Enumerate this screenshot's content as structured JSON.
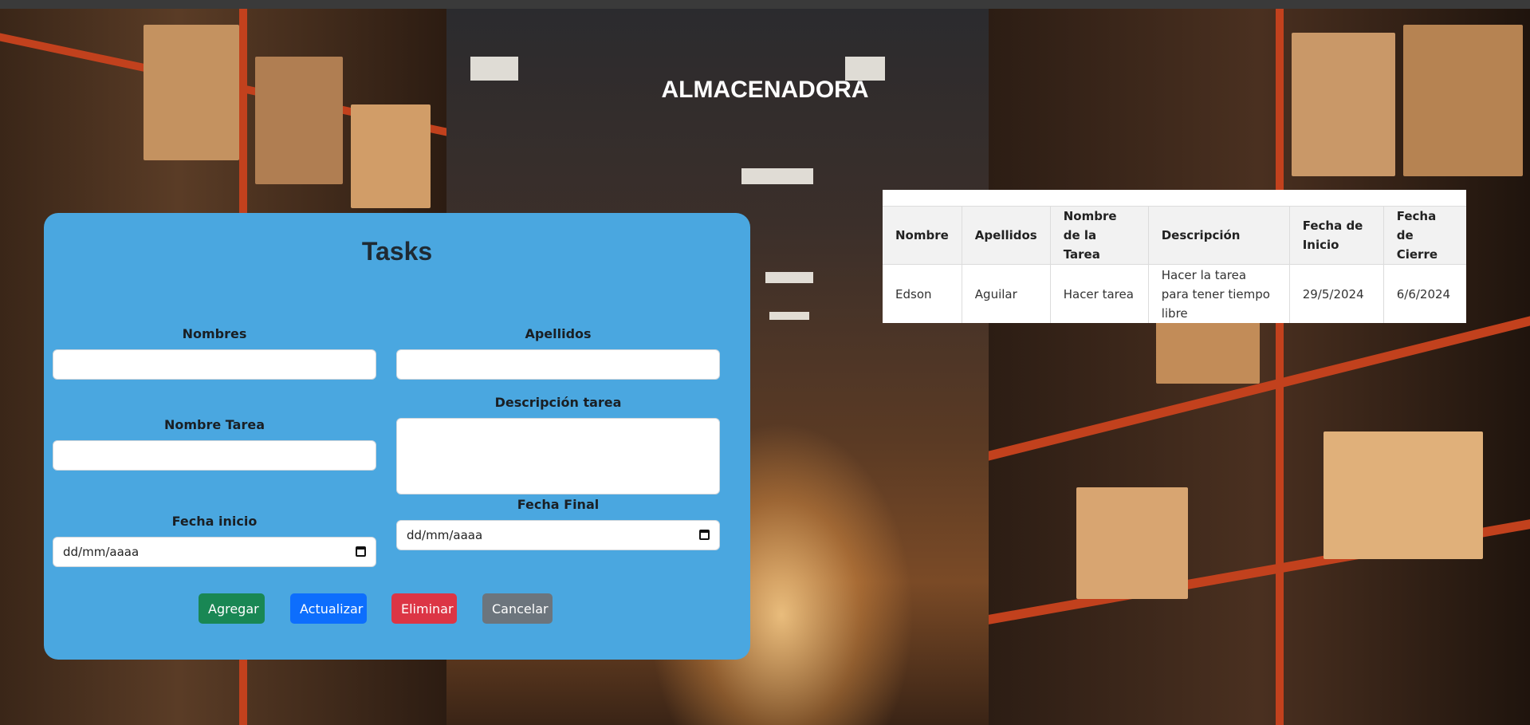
{
  "app": {
    "title": "ALMACENADORA"
  },
  "form": {
    "title": "Tasks",
    "nombres_label": "Nombres",
    "apellidos_label": "Apellidos",
    "nombre_tarea_label": "Nombre Tarea",
    "descripcion_label": "Descripción tarea",
    "fecha_inicio_label": "Fecha inicio",
    "fecha_final_label": "Fecha Final",
    "date_placeholder": "dd/mm/aaaa",
    "buttons": {
      "add": "Agregar",
      "update": "Actualizar",
      "delete": "Eliminar",
      "cancel": "Cancelar"
    },
    "button_colors": {
      "add": "#198754",
      "update": "#0d6efd",
      "delete": "#dc3545",
      "cancel": "#6c757d"
    },
    "card_color": "#4aa7e0"
  },
  "table": {
    "headers": [
      "Nombre",
      "Apellidos",
      "Nombre de la Tarea",
      "Descripción",
      "Fecha de Inicio",
      "Fecha de Cierre"
    ],
    "rows": [
      [
        "Edson",
        "Aguilar",
        "Hacer tarea",
        "Hacer la tarea para tener tiempo libre",
        "29/5/2024",
        "6/6/2024"
      ]
    ]
  },
  "icons": {
    "calendar": "calendar-icon"
  }
}
